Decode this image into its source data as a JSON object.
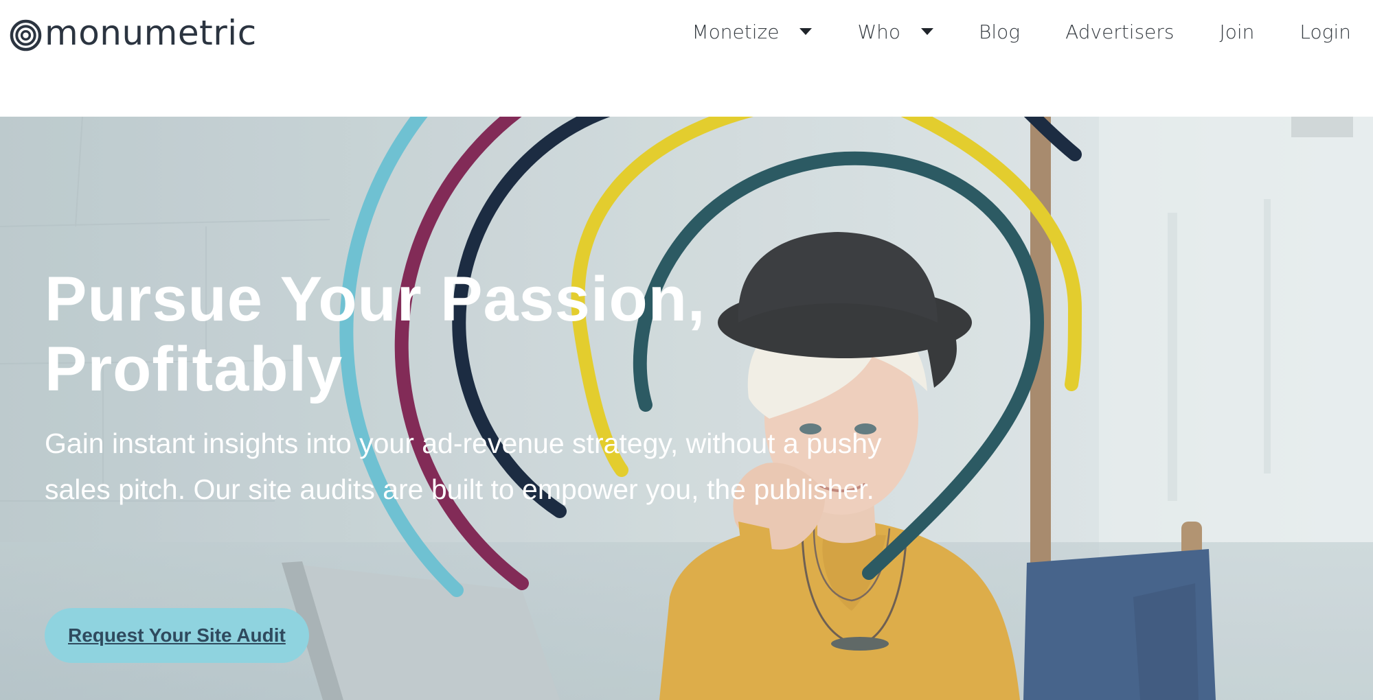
{
  "colors": {
    "brand_text": "#2b3440",
    "nav_text": "#343a40",
    "cta_background": "#8fd3df",
    "cta_text": "#2f4a5e",
    "arc_cyan": "#6fc1d2",
    "arc_magenta": "#822b57",
    "arc_navy": "#1c2c42",
    "arc_yellow": "#e3cd2e",
    "arc_teal": "#2c5a63"
  },
  "header": {
    "logo": {
      "icon": "concentric-circles-logo-icon",
      "text": "monumetric"
    },
    "nav": [
      {
        "label": "Monetize",
        "icon": "caret-down-icon"
      },
      {
        "label": "Who",
        "icon": "caret-down-icon"
      },
      {
        "label": "Blog"
      },
      {
        "label": "Advertisers"
      },
      {
        "label": "Join"
      },
      {
        "label": "Login"
      }
    ]
  },
  "hero": {
    "title_line1": "Pursue Your Passion,",
    "title_line2": "Profitably",
    "subtitle": "Gain instant insights into your ad-revenue strategy, without a pushy sales pitch. Our site audits are built to empower you, the publisher.",
    "cta_label": "Request Your Site Audit"
  }
}
